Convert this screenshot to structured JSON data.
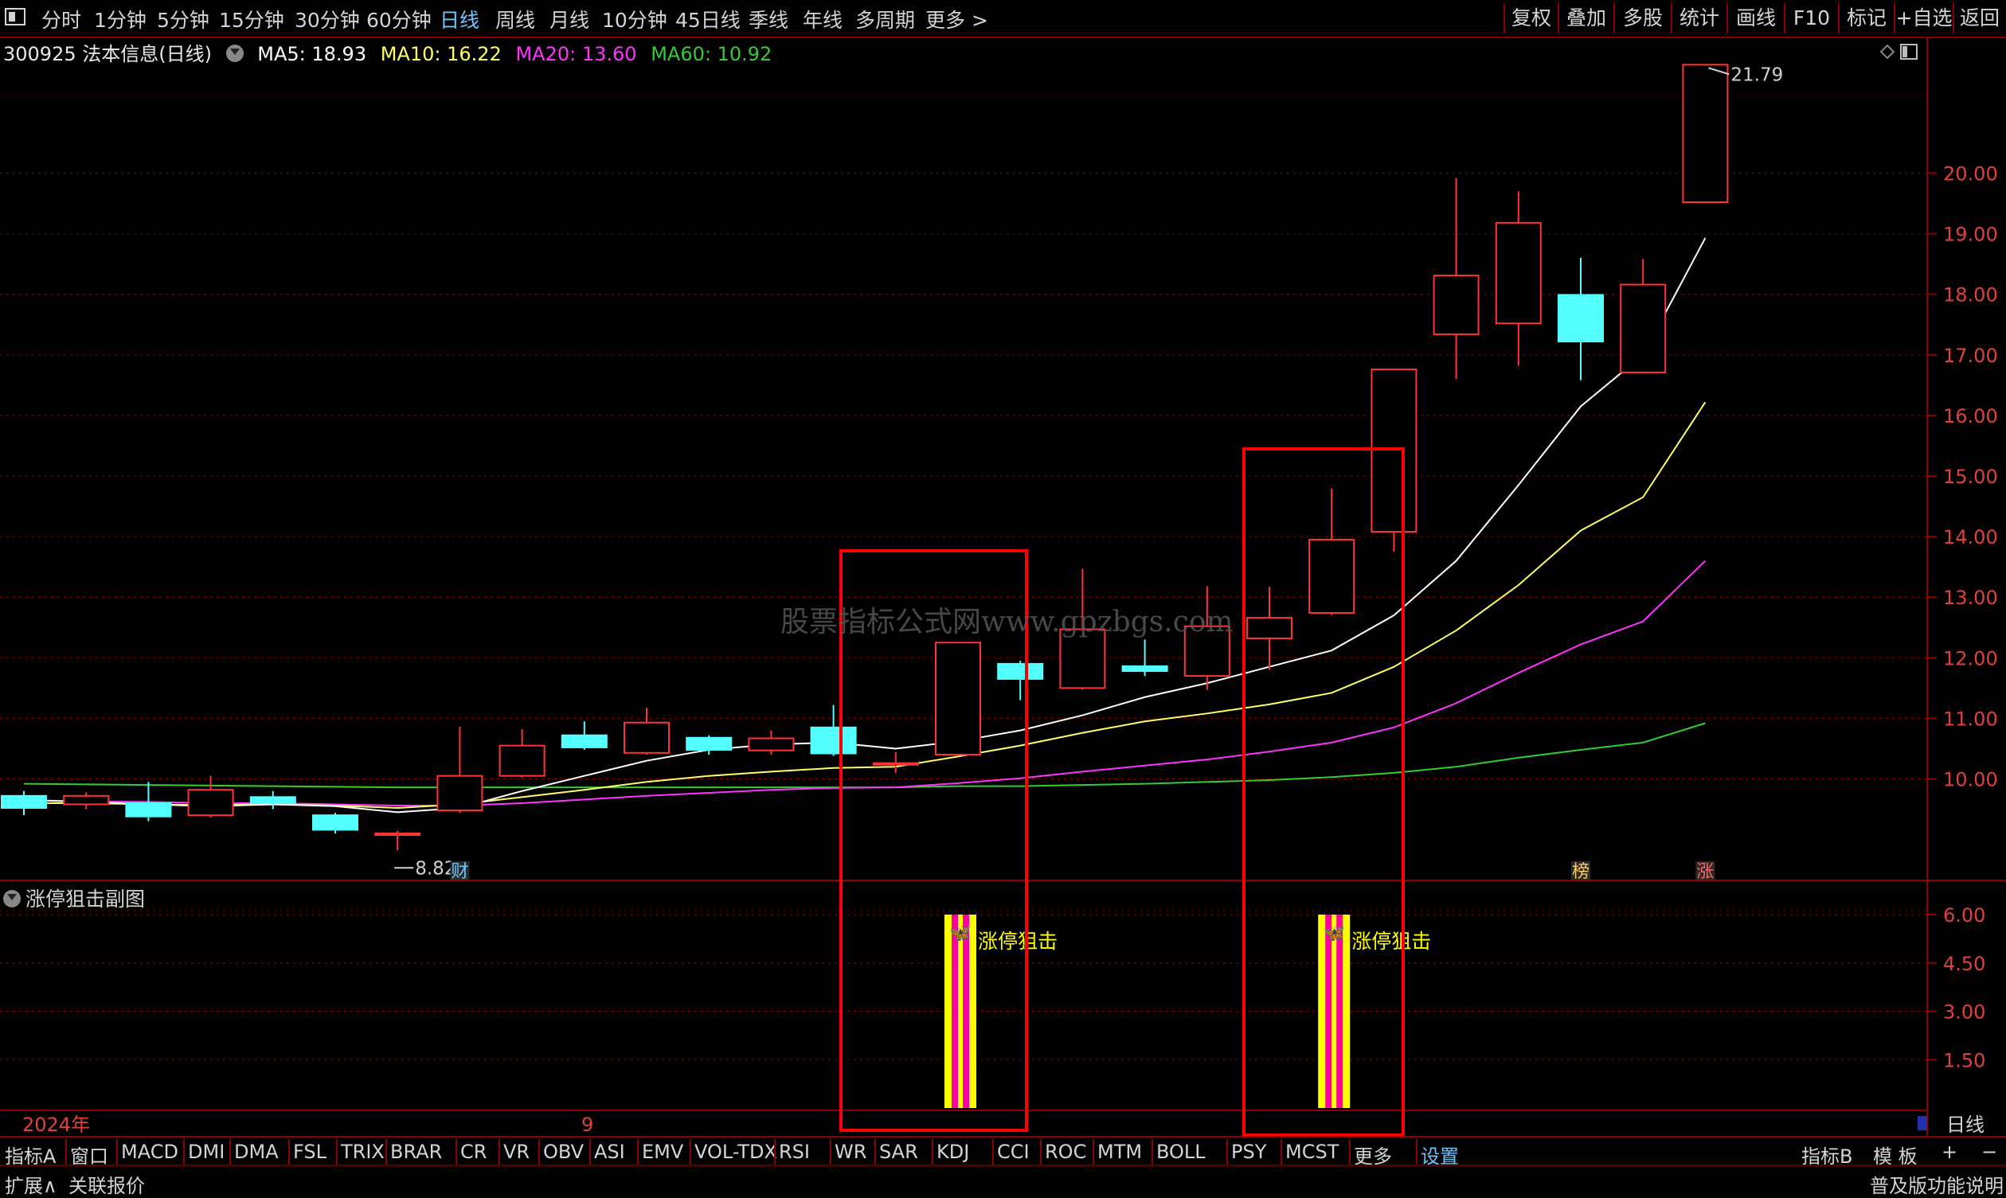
{
  "periods": [
    "分时",
    "1分钟",
    "5分钟",
    "15分钟",
    "30分钟",
    "60分钟",
    "日线",
    "周线",
    "月线",
    "10分钟",
    "45日线",
    "季线",
    "年线",
    "多周期",
    "更多 >"
  ],
  "active_period": "日线",
  "right_tools": [
    "复权",
    "叠加",
    "多股",
    "统计",
    "画线",
    "F10",
    "标记",
    "+自选",
    "返回"
  ],
  "stock": {
    "title": "300925 法本信息(日线)",
    "ma5": "MA5: 18.93",
    "ma10": "MA10: 16.22",
    "ma20": "MA20: 13.60",
    "ma60": "MA60: 10.92"
  },
  "colors": {
    "up": "#ff3333",
    "down": "#54ffff",
    "ma5": "#ffffff",
    "ma10": "#ffff66",
    "ma20": "#ff33ff",
    "ma60": "#33cc33",
    "grid": "#8b0000",
    "highlight": "#ff0000"
  },
  "chart_data": {
    "type": "candlestick",
    "ylim": [
      8.6,
      22.3
    ],
    "price_ticks": [
      "20.00",
      "19.00",
      "18.00",
      "17.00",
      "16.00",
      "15.00",
      "14.00",
      "13.00",
      "12.00",
      "11.00",
      "10.00"
    ],
    "high_label": "21.79",
    "low_label": "8.82",
    "candles": [
      {
        "o": 9.72,
        "c": 9.52,
        "h": 9.8,
        "l": 9.4
      },
      {
        "o": 9.58,
        "c": 9.72,
        "h": 9.78,
        "l": 9.5
      },
      {
        "o": 9.6,
        "c": 9.38,
        "h": 9.95,
        "l": 9.3
      },
      {
        "o": 9.4,
        "c": 9.82,
        "h": 10.05,
        "l": 9.36
      },
      {
        "o": 9.7,
        "c": 9.6,
        "h": 9.8,
        "l": 9.5
      },
      {
        "o": 9.4,
        "c": 9.16,
        "h": 9.44,
        "l": 9.1
      },
      {
        "o": 9.09,
        "c": 9.1,
        "h": 9.14,
        "l": 8.82
      },
      {
        "o": 9.48,
        "c": 10.05,
        "h": 10.86,
        "l": 9.44
      },
      {
        "o": 10.05,
        "c": 10.55,
        "h": 10.82,
        "l": 10.02
      },
      {
        "o": 10.72,
        "c": 10.52,
        "h": 10.95,
        "l": 10.48
      },
      {
        "o": 10.43,
        "c": 10.93,
        "h": 11.17,
        "l": 10.4
      },
      {
        "o": 10.68,
        "c": 10.48,
        "h": 10.72,
        "l": 10.4
      },
      {
        "o": 10.47,
        "c": 10.67,
        "h": 10.8,
        "l": 10.4
      },
      {
        "o": 10.85,
        "c": 10.42,
        "h": 11.22,
        "l": 10.38
      },
      {
        "o": 10.24,
        "c": 10.26,
        "h": 10.44,
        "l": 10.1
      },
      {
        "o": 10.4,
        "c": 12.25,
        "h": 12.25,
        "l": 10.4
      },
      {
        "o": 11.9,
        "c": 11.65,
        "h": 11.95,
        "l": 11.3
      },
      {
        "o": 11.5,
        "c": 12.47,
        "h": 13.47,
        "l": 11.47
      },
      {
        "o": 11.86,
        "c": 11.78,
        "h": 12.3,
        "l": 11.7
      },
      {
        "o": 11.7,
        "c": 12.52,
        "h": 13.18,
        "l": 11.47
      },
      {
        "o": 12.32,
        "c": 12.66,
        "h": 13.17,
        "l": 11.8
      },
      {
        "o": 12.74,
        "c": 13.95,
        "h": 14.8,
        "l": 12.7
      },
      {
        "o": 14.08,
        "c": 16.76,
        "h": 16.76,
        "l": 13.75
      },
      {
        "o": 17.34,
        "c": 18.31,
        "h": 19.92,
        "l": 16.6
      },
      {
        "o": 17.52,
        "c": 19.18,
        "h": 19.7,
        "l": 16.82
      },
      {
        "o": 17.99,
        "c": 17.22,
        "h": 18.6,
        "l": 16.58
      },
      {
        "o": 16.71,
        "c": 18.16,
        "h": 18.58,
        "l": 16.7
      },
      {
        "o": 19.52,
        "c": 21.79,
        "h": 21.79,
        "l": 19.52
      }
    ],
    "ma5": [
      9.65,
      9.62,
      9.58,
      9.55,
      9.58,
      9.55,
      9.45,
      9.52,
      9.8,
      10.05,
      10.3,
      10.48,
      10.57,
      10.6,
      10.5,
      10.62,
      10.8,
      11.05,
      11.35,
      11.58,
      11.85,
      12.12,
      12.7,
      13.6,
      14.85,
      16.15,
      17.0,
      18.93
    ],
    "ma10": [
      9.6,
      9.6,
      9.58,
      9.57,
      9.58,
      9.56,
      9.52,
      9.58,
      9.7,
      9.82,
      9.95,
      10.05,
      10.12,
      10.18,
      10.2,
      10.37,
      10.55,
      10.76,
      10.95,
      11.08,
      11.23,
      11.42,
      11.85,
      12.45,
      13.2,
      14.1,
      14.65,
      16.22
    ],
    "ma20": [
      9.65,
      9.63,
      9.62,
      9.6,
      9.6,
      9.58,
      9.56,
      9.56,
      9.6,
      9.66,
      9.72,
      9.77,
      9.82,
      9.85,
      9.86,
      9.93,
      10.01,
      10.12,
      10.22,
      10.32,
      10.45,
      10.6,
      10.85,
      11.25,
      11.75,
      12.22,
      12.6,
      13.6
    ],
    "ma60": [
      9.92,
      9.91,
      9.9,
      9.89,
      9.88,
      9.87,
      9.86,
      9.86,
      9.86,
      9.86,
      9.86,
      9.86,
      9.86,
      9.86,
      9.86,
      9.88,
      9.88,
      9.9,
      9.92,
      9.95,
      9.98,
      10.03,
      10.1,
      10.2,
      10.35,
      10.48,
      10.6,
      10.92
    ],
    "markers": [
      {
        "index": 7,
        "label": "财"
      },
      {
        "index": 25,
        "label": "榜"
      },
      {
        "index": 27,
        "label": "涨"
      }
    ],
    "x_labels": [
      "2024年",
      "9"
    ],
    "sub_chart": {
      "title": "涨停狙击副图",
      "ylim": [
        0,
        6.6
      ],
      "ticks": [
        "6.00",
        "4.50",
        "3.00",
        "1.50"
      ],
      "signals": [
        {
          "index": 15,
          "value": 6.0,
          "label": "涨停狙击"
        },
        {
          "index": 21,
          "value": 6.0,
          "label": "涨停狙击"
        }
      ]
    }
  },
  "watermark": "股票指标公式网www.gpzbgs.com",
  "indicator_tabs": [
    "指标A",
    "窗口",
    "MACD",
    "DMI",
    "DMA",
    "FSL",
    "TRIX",
    "BRAR",
    "CR",
    "VR",
    "OBV",
    "ASI",
    "EMV",
    "VOL-TDX",
    "RSI",
    "WR",
    "SAR",
    "KDJ",
    "CCI",
    "ROC",
    "MTM",
    "BOLL",
    "PSY",
    "MCST",
    "更多",
    "设置"
  ],
  "active_indicator_tab": "设置",
  "indicator_right": [
    "指标B",
    "模 板",
    "+",
    "−"
  ],
  "period_label": "日线",
  "status_left": [
    "扩展∧",
    "关联报价"
  ],
  "status_right": "普及版功能说明"
}
